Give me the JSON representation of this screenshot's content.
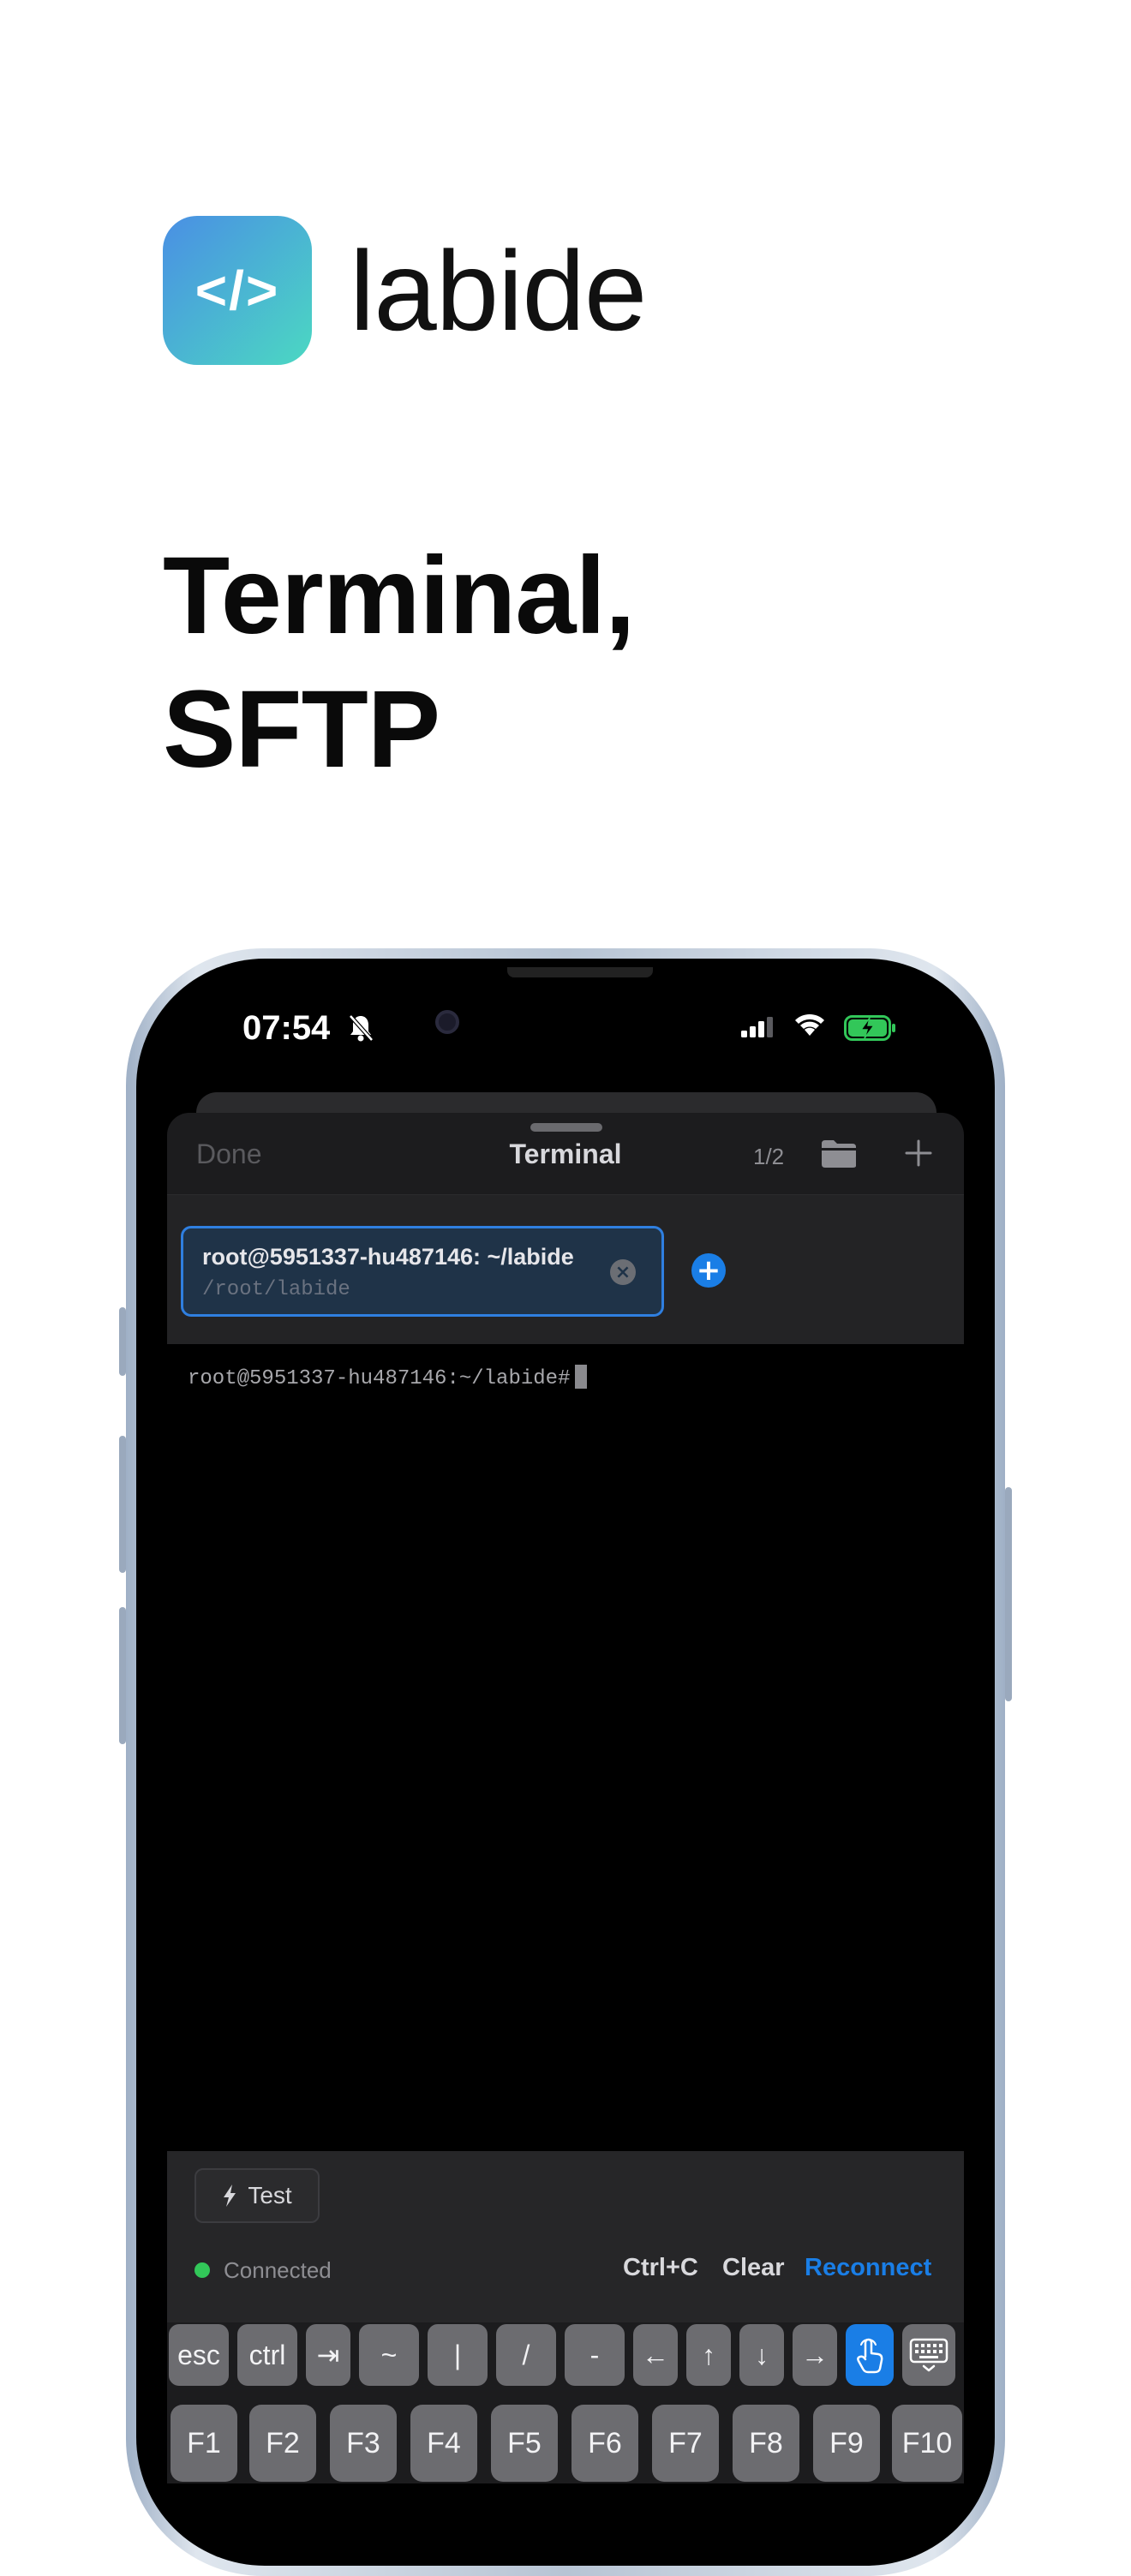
{
  "brand": {
    "logo_glyph": "</>",
    "name": "labide",
    "logo_gradient": [
      "#4a8fe4",
      "#4bd8c2"
    ]
  },
  "headline": {
    "line1": "Terminal,",
    "line2": "SFTP"
  },
  "status_bar": {
    "time": "07:54",
    "icons": [
      "bell-slash-icon",
      "cellular-signal-icon",
      "wifi-icon",
      "battery-charging-icon"
    ]
  },
  "nav": {
    "done_label": "Done",
    "title": "Terminal",
    "session_count": "1/2",
    "icons": [
      "folder-icon",
      "plus-icon"
    ]
  },
  "session_tab": {
    "title": "root@5951337-hu487146: ~/labide",
    "path": "/root/labide",
    "close_glyph": "×",
    "add_glyph": "+"
  },
  "terminal": {
    "prompt": "root@5951337-hu487146:~/labide#"
  },
  "controls": {
    "test_label": "Test",
    "status": "Connected",
    "ctrl_c": "Ctrl+C",
    "clear": "Clear",
    "reconnect": "Reconnect"
  },
  "accessory_keys": [
    "esc",
    "ctrl",
    "⇥",
    "~",
    "|",
    "/",
    "-",
    "←",
    "↑",
    "↓",
    "→"
  ],
  "function_keys": [
    "F1",
    "F2",
    "F3",
    "F4",
    "F5",
    "F6",
    "F7",
    "F8",
    "F9",
    "F10"
  ],
  "colors": {
    "accent": "#1a7ee6",
    "connected": "#32c759",
    "battery": "#32c759"
  }
}
